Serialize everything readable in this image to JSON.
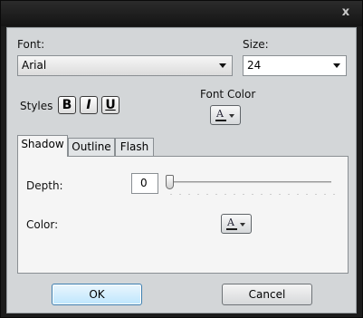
{
  "titlebar": {
    "close_glyph": "x",
    "close_icon": "close-icon"
  },
  "font": {
    "label": "Font:",
    "value": "Arial"
  },
  "size": {
    "label": "Size:",
    "value": "24"
  },
  "styles": {
    "label": "Styles",
    "bold": "B",
    "italic": "I",
    "underline": "U"
  },
  "font_color": {
    "label": "Font Color",
    "glyph": "A",
    "icon": "font-color-icon",
    "swatch": "#1a1a1a"
  },
  "tabs": [
    {
      "label": "Shadow",
      "active": true
    },
    {
      "label": "Outline",
      "active": false
    },
    {
      "label": "Flash",
      "active": false
    }
  ],
  "shadow": {
    "depth_label": "Depth:",
    "depth_value": "0",
    "color_label": "Color:",
    "color_glyph": "A",
    "color_icon": "shadow-color-icon"
  },
  "buttons": {
    "ok": "OK",
    "cancel": "Cancel"
  },
  "colors": {
    "client_bg": "#d3d6d8",
    "titlebar": "#1c1c1c",
    "default_button": "#bee6fd"
  }
}
